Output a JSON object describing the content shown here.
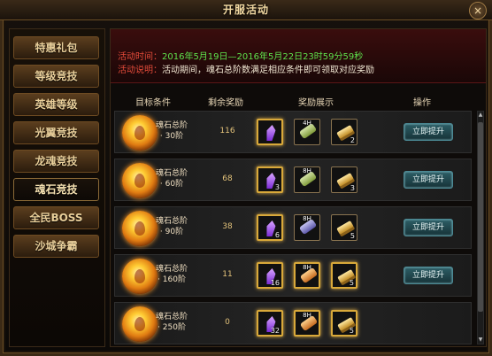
{
  "window": {
    "title": "开服活动",
    "close_icon": "×"
  },
  "sidebar": {
    "items": [
      {
        "label": "特惠礼包",
        "active": false
      },
      {
        "label": "等级竞技",
        "active": false
      },
      {
        "label": "英雄等级",
        "active": false
      },
      {
        "label": "光翼竞技",
        "active": false
      },
      {
        "label": "龙魂竞技",
        "active": false
      },
      {
        "label": "魂石竞技",
        "active": true
      },
      {
        "label": "全民BOSS",
        "active": false
      },
      {
        "label": "沙城争霸",
        "active": false
      }
    ]
  },
  "info": {
    "time_label": "活动时间：",
    "time_value": "2016年5月19日—2016年5月22日23时59分59秒",
    "desc_label": "活动说明：",
    "desc_value": "活动期间，魂石总阶数满足相应条件即可领取对应奖励"
  },
  "table": {
    "headers": {
      "target": "目标条件",
      "remaining": "剩余奖励",
      "rewards": "奖励展示",
      "operation": "操作"
    },
    "rows": [
      {
        "name_line1": "魂石总阶",
        "name_line2": "· 30阶",
        "remaining": "116",
        "reward1_qty": "",
        "reward2_tag": "4H",
        "reward2_color": "green",
        "reward3_qty": "2",
        "button": "立即提升"
      },
      {
        "name_line1": "魂石总阶",
        "name_line2": "· 60阶",
        "remaining": "68",
        "reward1_qty": "3",
        "reward2_tag": "8H",
        "reward2_color": "green",
        "reward3_qty": "3",
        "button": "立即提升"
      },
      {
        "name_line1": "魂石总阶",
        "name_line2": "· 90阶",
        "remaining": "38",
        "reward1_qty": "6",
        "reward2_tag": "8H",
        "reward2_color": "blue",
        "reward3_qty": "5",
        "button": "立即提升"
      },
      {
        "name_line1": "魂石总阶",
        "name_line2": "· 160阶",
        "remaining": "11",
        "reward1_qty": "16",
        "reward2_tag": "8H",
        "reward2_color": "orange",
        "reward3_qty": "5",
        "button": "立即提升"
      },
      {
        "name_line1": "魂石总阶",
        "name_line2": "· 250阶",
        "remaining": "0",
        "reward1_qty": "32",
        "reward2_tag": "8H",
        "reward2_color": "orange",
        "reward3_qty": "5",
        "button": ""
      }
    ]
  },
  "scrollbar": {
    "up_icon": "▲",
    "down_icon": "▼"
  }
}
